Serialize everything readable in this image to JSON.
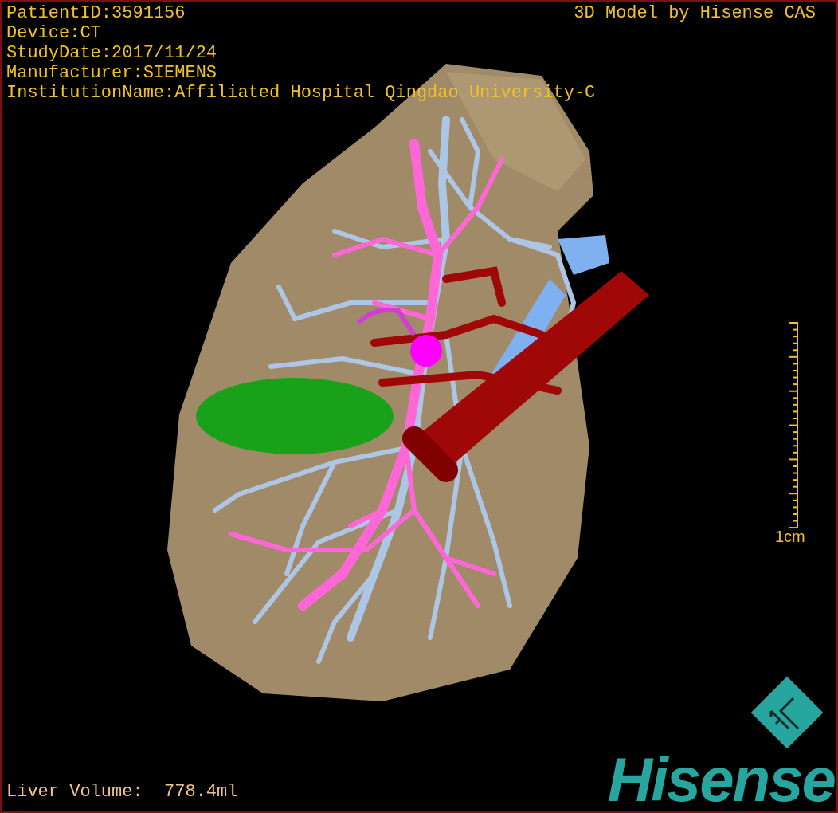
{
  "info_lines": [
    "PatientID:3591156",
    "Device:CT",
    "StudyDate:2017/11/24",
    "Manufacturer:SIEMENS",
    "InstitutionName:Affiliated Hospital Qingdao University-C"
  ],
  "title": "3D Model by Hisense CAS",
  "scale": {
    "label": "1cm"
  },
  "liver_volume": "Liver Volume:  778.4ml",
  "logo": {
    "text": "Hisense"
  }
}
